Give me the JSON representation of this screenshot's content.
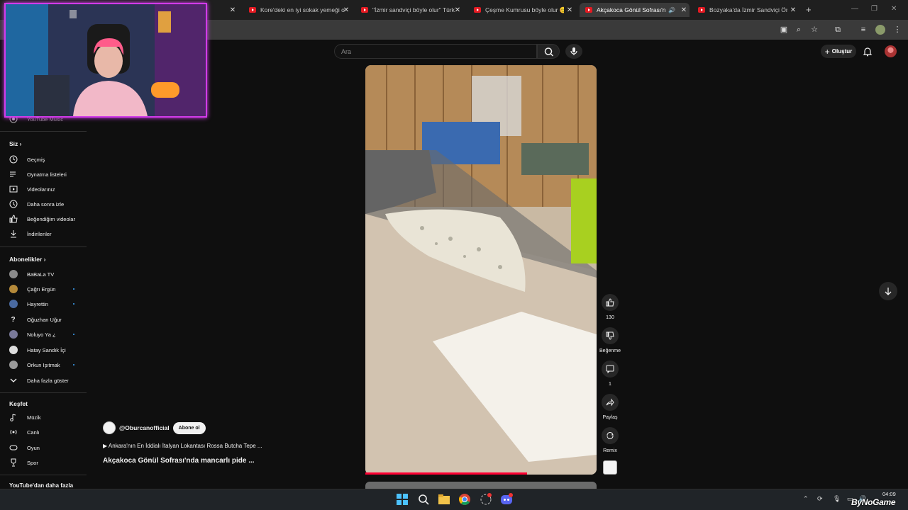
{
  "browser": {
    "tabs": [
      {
        "title": "Kore'deki en iyi sokak yemeği o"
      },
      {
        "title": "\"İzmir sandviçi böyle olur\" Türk"
      },
      {
        "title": "Çeşme Kumrusu böyle olur 😊"
      },
      {
        "title": "Akçakoca Gönül Sofrası'nd",
        "active": true
      },
      {
        "title": "Bozyaka'da İzmir Sandviçi Öne"
      }
    ],
    "new_tab_glyph": "+",
    "window_controls": [
      "—",
      "❐",
      "✕"
    ]
  },
  "youtube": {
    "search_placeholder": "Ara",
    "create_label": "Oluştur",
    "sidebar": {
      "top_item": "YouTube Music",
      "you_header": "Siz",
      "you_items": [
        {
          "label": "Geçmiş",
          "icon": "history-icon"
        },
        {
          "label": "Oynatma listeleri",
          "icon": "playlist-icon"
        },
        {
          "label": "Videolarınız",
          "icon": "your-videos-icon"
        },
        {
          "label": "Daha sonra izle",
          "icon": "watch-later-icon"
        },
        {
          "label": "Beğendiğim videolar",
          "icon": "like-icon"
        },
        {
          "label": "İndirilenler",
          "icon": "download-icon"
        }
      ],
      "subs_header": "Abonelikler",
      "subs": [
        {
          "label": "BaBaLa TV",
          "color": "#8a8a8a",
          "live": false
        },
        {
          "label": "Çağrı Ergün",
          "color": "#b58a3a",
          "live": true
        },
        {
          "label": "Hayrettin",
          "color": "#4a6aa0",
          "live": true
        },
        {
          "label": "Oğuzhan Uğur",
          "color": "#0f0f0f",
          "live": false
        },
        {
          "label": "Noluyo Ya ¿",
          "color": "#7a7a9a",
          "live": true
        },
        {
          "label": "Hatay Sandık İçi",
          "color": "#dddddd",
          "live": false
        },
        {
          "label": "Orkun Işıtmak",
          "color": "#9a9a9a",
          "live": true
        }
      ],
      "show_more": "Daha fazla göster",
      "explore_header": "Keşfet",
      "explore": [
        {
          "label": "Müzik",
          "icon": "music-icon"
        },
        {
          "label": "Canlı",
          "icon": "live-icon"
        },
        {
          "label": "Oyun",
          "icon": "gaming-icon"
        },
        {
          "label": "Spor",
          "icon": "sports-icon"
        }
      ],
      "more_header": "YouTube'dan daha fazla"
    },
    "short": {
      "channel": "@Oburcanofficial",
      "subscribe": "Abone ol",
      "playlist_line": "▶ Ankara'nın En İddialı İtalyan Lokantası Rossa Butcha Tepe ...",
      "title": "Akçakoca Gönül Sofrası'nda mancarlı pide ...",
      "likes": "130",
      "dislike_label": "Beğenme",
      "comments": "1",
      "share_label": "Paylaş",
      "remix_label": "Remix",
      "progress": 0.7
    }
  },
  "taskbar": {
    "time": "04:09",
    "watermark": "ByNoGame"
  }
}
